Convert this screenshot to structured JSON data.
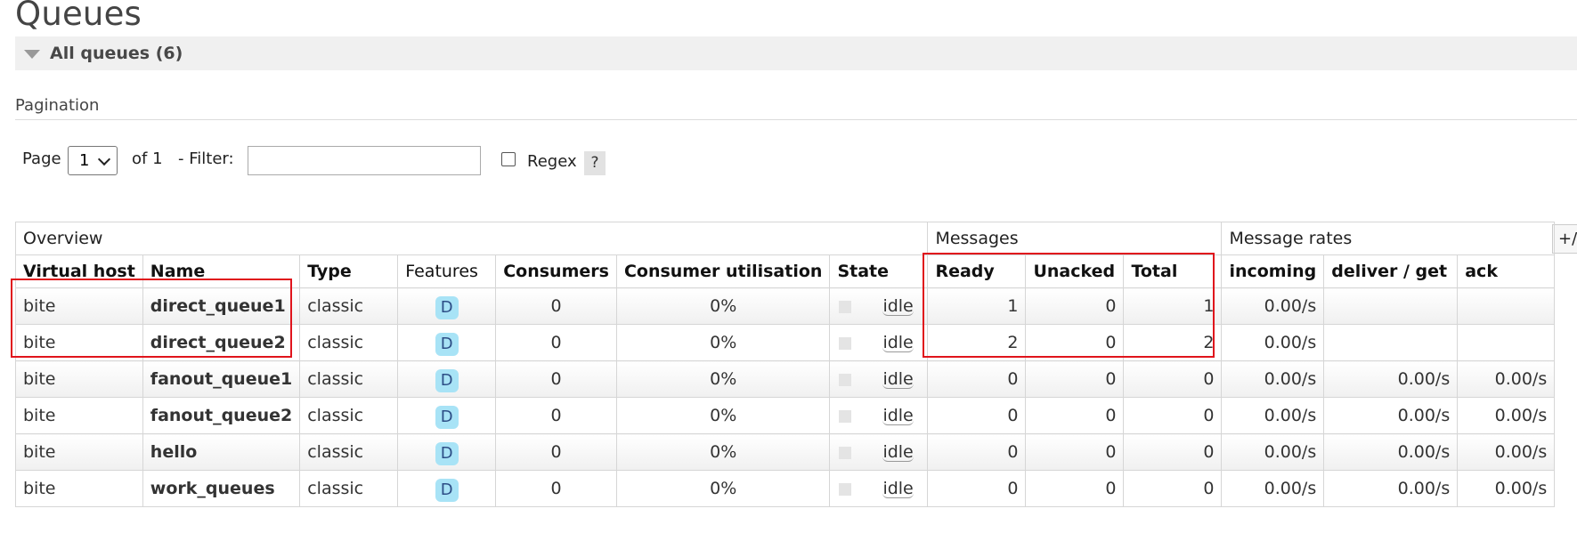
{
  "page_title": "Queues",
  "section": {
    "label": "All queues (6)"
  },
  "pagination": {
    "label": "Pagination",
    "page_label": "Page",
    "page_value": "1",
    "of_label": "of 1",
    "filter_label": "- Filter:",
    "filter_value": "",
    "regex_label": "Regex",
    "help_label": "?"
  },
  "column_toggle": "+/-",
  "table": {
    "groups": [
      "Overview",
      "Messages",
      "Message rates"
    ],
    "headers": [
      "Virtual host",
      "Name",
      "Type",
      "Features",
      "Consumers",
      "Consumer utilisation",
      "State",
      "Ready",
      "Unacked",
      "Total",
      "incoming",
      "deliver / get",
      "ack"
    ],
    "rows": [
      {
        "vhost": "bite",
        "name": "direct_queue1",
        "type": "classic",
        "feature": "D",
        "consumers": "0",
        "utilisation": "0%",
        "state": "idle",
        "ready": "1",
        "unacked": "0",
        "total": "1",
        "incoming": "0.00/s",
        "deliver_get": "",
        "ack": ""
      },
      {
        "vhost": "bite",
        "name": "direct_queue2",
        "type": "classic",
        "feature": "D",
        "consumers": "0",
        "utilisation": "0%",
        "state": "idle",
        "ready": "2",
        "unacked": "0",
        "total": "2",
        "incoming": "0.00/s",
        "deliver_get": "",
        "ack": ""
      },
      {
        "vhost": "bite",
        "name": "fanout_queue1",
        "type": "classic",
        "feature": "D",
        "consumers": "0",
        "utilisation": "0%",
        "state": "idle",
        "ready": "0",
        "unacked": "0",
        "total": "0",
        "incoming": "0.00/s",
        "deliver_get": "0.00/s",
        "ack": "0.00/s"
      },
      {
        "vhost": "bite",
        "name": "fanout_queue2",
        "type": "classic",
        "feature": "D",
        "consumers": "0",
        "utilisation": "0%",
        "state": "idle",
        "ready": "0",
        "unacked": "0",
        "total": "0",
        "incoming": "0.00/s",
        "deliver_get": "0.00/s",
        "ack": "0.00/s"
      },
      {
        "vhost": "bite",
        "name": "hello",
        "type": "classic",
        "feature": "D",
        "consumers": "0",
        "utilisation": "0%",
        "state": "idle",
        "ready": "0",
        "unacked": "0",
        "total": "0",
        "incoming": "0.00/s",
        "deliver_get": "0.00/s",
        "ack": "0.00/s"
      },
      {
        "vhost": "bite",
        "name": "work_queues",
        "type": "classic",
        "feature": "D",
        "consumers": "0",
        "utilisation": "0%",
        "state": "idle",
        "ready": "0",
        "unacked": "0",
        "total": "0",
        "incoming": "0.00/s",
        "deliver_get": "0.00/s",
        "ack": "0.00/s"
      }
    ]
  },
  "colors": {
    "highlight": "#e0141c",
    "feature_badge": "#a8e3f6",
    "feature_text": "#2d4e86"
  }
}
